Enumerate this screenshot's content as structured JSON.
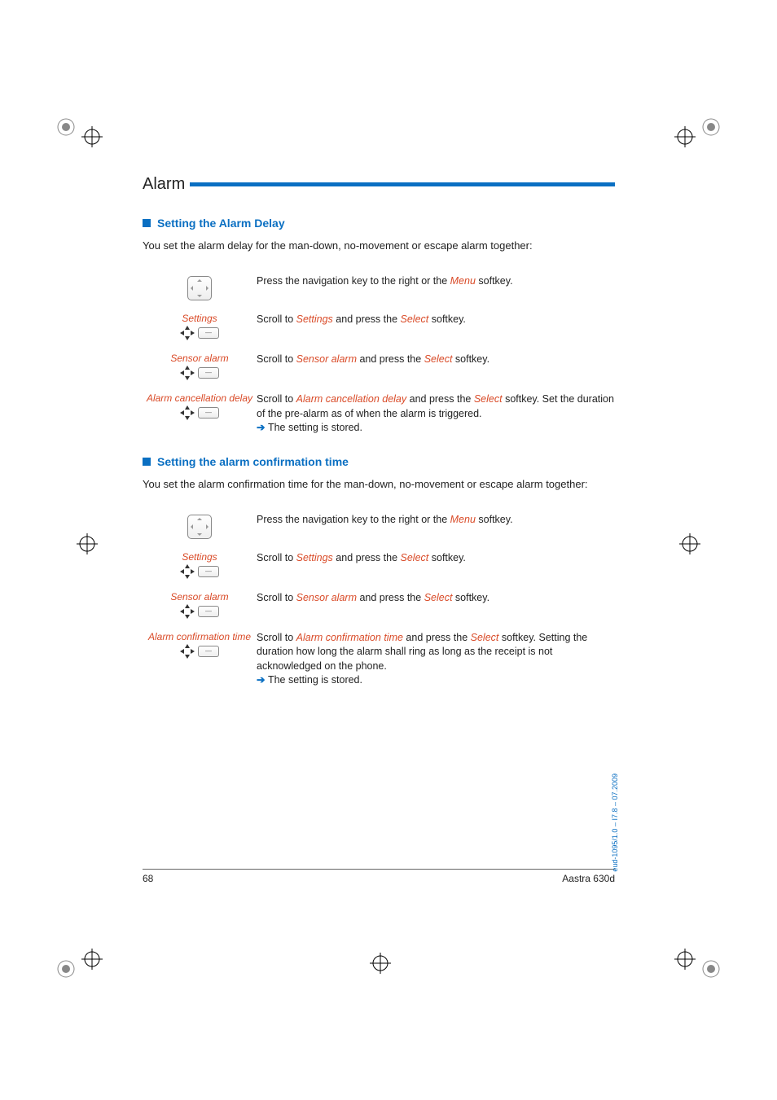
{
  "page": {
    "title": "Alarm",
    "pageNumber": "68",
    "productName": "Aastra 630d",
    "docId": "eud-1095/1.0 – I7.8 – 07.2009"
  },
  "section1": {
    "heading": "Setting the Alarm Delay",
    "intro": "You set the alarm delay for the man-down, no-movement or escape alarm together:",
    "steps": [
      {
        "label": "",
        "textPre": "Press the navigation key to the right or the ",
        "term1": "Menu",
        "textPost1": " softkey.",
        "iconType": "navkey"
      },
      {
        "label": "Settings",
        "textPre": "Scroll to ",
        "term1": "Settings",
        "textMid1": " and press the ",
        "term2": "Select",
        "textPost2": " softkey.",
        "iconType": "dpad"
      },
      {
        "label": "Sensor alarm",
        "textPre": "Scroll to ",
        "term1": "Sensor alarm",
        "textMid1": " and press the ",
        "term2": "Select",
        "textPost2": " softkey.",
        "iconType": "dpad"
      },
      {
        "label": "Alarm cancellation delay",
        "textPre": "Scroll to ",
        "term1": "Alarm cancellation delay",
        "textMid1": " and press the ",
        "term2": "Select",
        "textPost2": " softkey. Set the duration of the pre-alarm as of when the alarm is triggered.",
        "result": "The setting is stored.",
        "iconType": "dpad"
      }
    ]
  },
  "section2": {
    "heading": "Setting the alarm confirmation time",
    "intro": "You set the alarm confirmation time for the man-down, no-movement or escape alarm together:",
    "steps": [
      {
        "label": "",
        "textPre": "Press the navigation key to the right or the ",
        "term1": "Menu",
        "textPost1": " softkey.",
        "iconType": "navkey"
      },
      {
        "label": "Settings",
        "textPre": "Scroll to ",
        "term1": "Settings",
        "textMid1": " and press the ",
        "term2": "Select",
        "textPost2": " softkey.",
        "iconType": "dpad"
      },
      {
        "label": "Sensor alarm",
        "textPre": "Scroll to ",
        "term1": "Sensor alarm",
        "textMid1": " and press the ",
        "term2": "Select",
        "textPost2": " softkey.",
        "iconType": "dpad"
      },
      {
        "label": "Alarm confirmation time",
        "textPre": "Scroll to ",
        "term1": "Alarm confirmation time",
        "textMid1": " and press the ",
        "term2": "Select",
        "textPost2": " softkey. Setting the duration how long the alarm shall ring as long as the receipt is not acknowledged on the phone.",
        "result": "The setting is stored.",
        "iconType": "dpad"
      }
    ]
  }
}
